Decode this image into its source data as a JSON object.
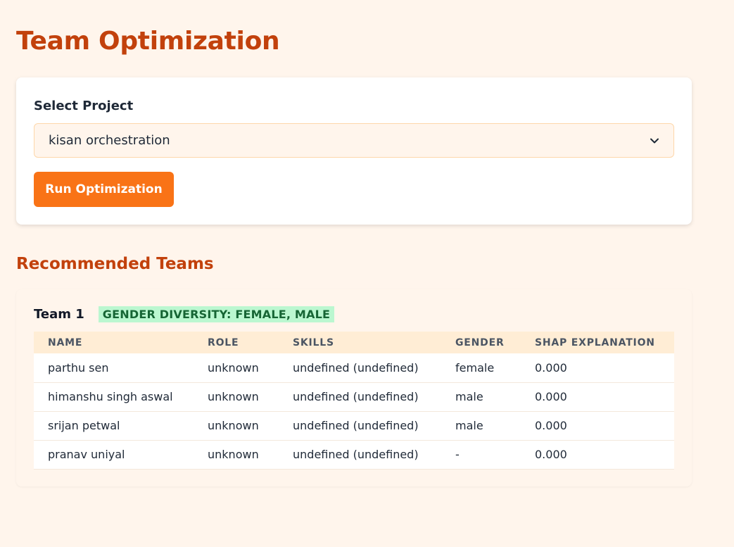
{
  "page": {
    "title": "Team Optimization"
  },
  "project_form": {
    "label": "Select Project",
    "selected_project": "kisan orchestration",
    "run_button": "Run Optimization"
  },
  "results": {
    "section_title": "Recommended Teams",
    "teams": [
      {
        "name": "Team 1",
        "diversity_badge": "GENDER DIVERSITY: FEMALE, MALE",
        "columns": [
          "NAME",
          "ROLE",
          "SKILLS",
          "GENDER",
          "SHAP EXPLANATION"
        ],
        "members": [
          {
            "name": "parthu sen",
            "role": "unknown",
            "skills": "undefined (undefined)",
            "gender": "female",
            "shap": "0.000"
          },
          {
            "name": "himanshu singh aswal",
            "role": "unknown",
            "skills": "undefined (undefined)",
            "gender": "male",
            "shap": "0.000"
          },
          {
            "name": "srijan petwal",
            "role": "unknown",
            "skills": "undefined (undefined)",
            "gender": "male",
            "shap": "0.000"
          },
          {
            "name": "pranav uniyal",
            "role": "unknown",
            "skills": "undefined (undefined)",
            "gender": "-",
            "shap": "0.000"
          }
        ]
      }
    ]
  },
  "colors": {
    "accent": "#f97316",
    "heading": "#c2410c",
    "background": "#fff5ec",
    "badge": "#bbf7d0"
  },
  "icons": {
    "select_chevron": "chevron-down-icon"
  }
}
